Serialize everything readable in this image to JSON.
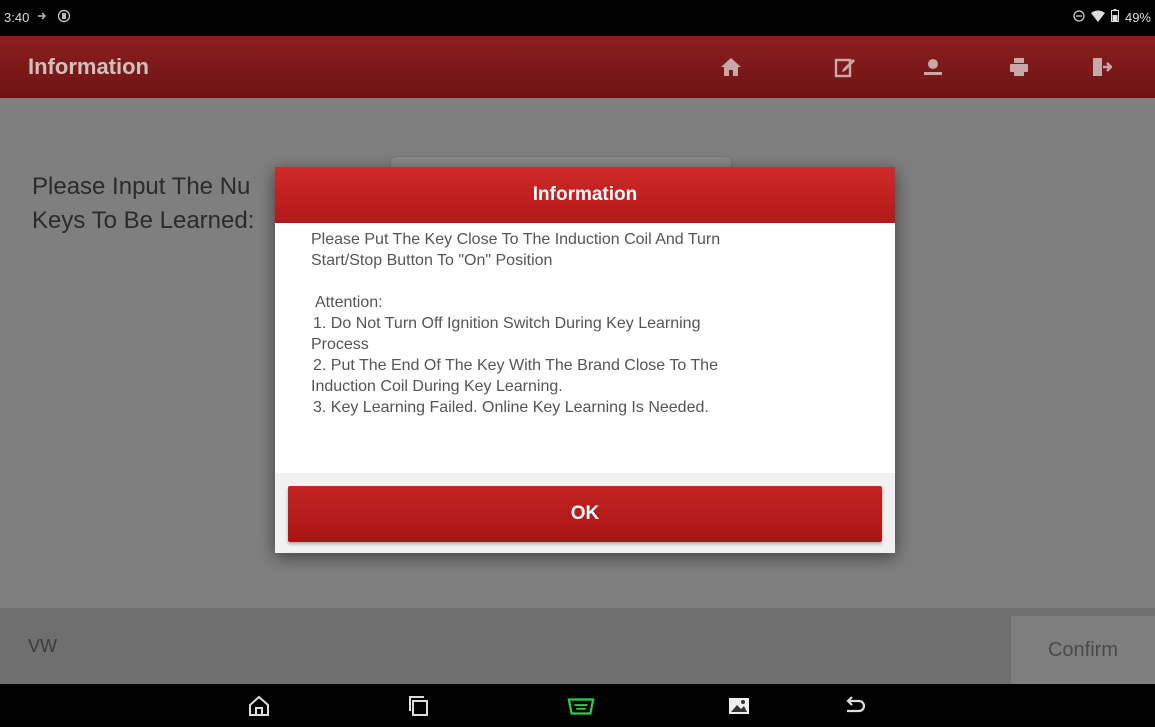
{
  "status_bar": {
    "time": "3:40",
    "battery": "49%"
  },
  "header": {
    "title": "Information"
  },
  "main": {
    "prompt_line1": "Please Input The Nu",
    "prompt_line2": "Keys To Be Learned:"
  },
  "footer": {
    "label": "VW",
    "confirm_label": "Confirm"
  },
  "dialog": {
    "title": "Information",
    "line1": "Please Put The Key Close To The Induction Coil And Turn",
    "line2": "Start/Stop Button To \"On\" Position",
    "attention_title": "Attention:",
    "item1_a": "1. Do Not Turn Off Ignition Switch During Key Learning",
    "item1_b": "Process",
    "item2_a": "2. Put The End Of The Key With The Brand Close To The",
    "item2_b": "Induction Coil During Key Learning.",
    "item3": "3. Key Learning Failed. Online Key Learning Is Needed.",
    "ok_label": "OK"
  },
  "colors": {
    "header": "#7c1a1a",
    "dialog_header": "#c01f1f",
    "ok_button": "#b81a1a",
    "nav_active": "#2ecc40"
  }
}
